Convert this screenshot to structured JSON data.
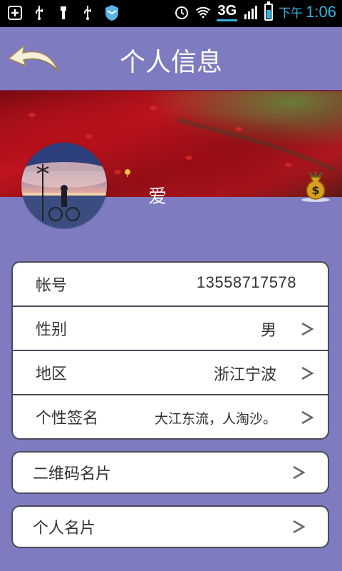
{
  "status_bar": {
    "network": "3G",
    "time_prefix": "下午",
    "time": "1:06",
    "battery_level": 0.6,
    "colors": {
      "accent": "#33b5e5"
    }
  },
  "header": {
    "title": "个人信息",
    "back_icon": "back-arrow-icon"
  },
  "profile": {
    "nickname": "爱",
    "wallet_icon": "money-bag-icon"
  },
  "info_list": {
    "rows": [
      {
        "label": "帐号",
        "value": "13558717578"
      },
      {
        "label": "性别",
        "value": "男"
      },
      {
        "label": "地区",
        "value": "浙江宁波"
      },
      {
        "label": "个性签名",
        "value": "大江东流，人淘沙。"
      }
    ]
  },
  "qr_card": {
    "label": "二维码名片"
  },
  "personal_card": {
    "label": "个人名片"
  },
  "colors": {
    "background": "#7e7bc0",
    "card_border": "#4a4a5a"
  }
}
